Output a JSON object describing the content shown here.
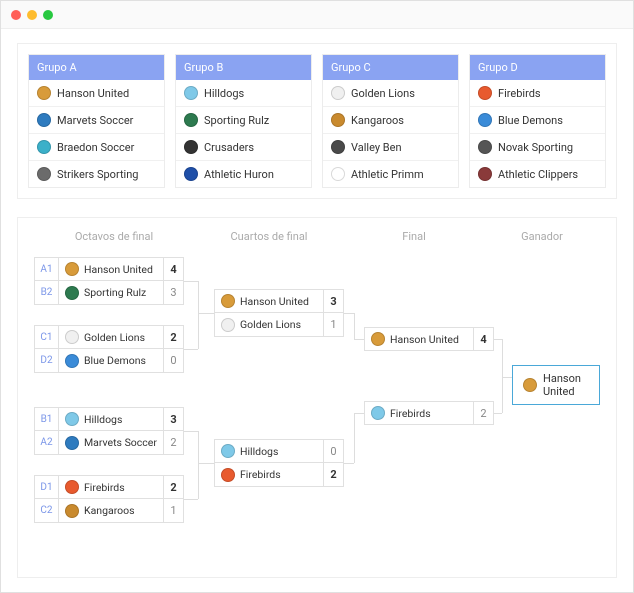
{
  "groups": [
    {
      "title": "Grupo A",
      "teams": [
        {
          "name": "Hanson United",
          "badge": "#d89b3a"
        },
        {
          "name": "Marvets Soccer",
          "badge": "#2e7bbf"
        },
        {
          "name": "Braedon Soccer",
          "badge": "#3bb0c9"
        },
        {
          "name": "Strikers Sporting",
          "badge": "#6b6b6b"
        }
      ]
    },
    {
      "title": "Grupo B",
      "teams": [
        {
          "name": "Hilldogs",
          "badge": "#7fc9e8"
        },
        {
          "name": "Sporting Rulz",
          "badge": "#2d7a4f"
        },
        {
          "name": "Crusaders",
          "badge": "#333333"
        },
        {
          "name": "Athletic Huron",
          "badge": "#1f4fa8"
        }
      ]
    },
    {
      "title": "Grupo C",
      "teams": [
        {
          "name": "Golden Lions",
          "badge": "#f0f0f0"
        },
        {
          "name": "Kangaroos",
          "badge": "#c98a2e"
        },
        {
          "name": "Valley Ben",
          "badge": "#4a4a4a"
        },
        {
          "name": "Athletic Primm",
          "badge": "#ffffff"
        }
      ]
    },
    {
      "title": "Grupo D",
      "teams": [
        {
          "name": "Firebirds",
          "badge": "#e85a2e"
        },
        {
          "name": "Blue Demons",
          "badge": "#3a8bd8"
        },
        {
          "name": "Novak Sporting",
          "badge": "#555555"
        },
        {
          "name": "Athletic Clippers",
          "badge": "#8a3a3a"
        }
      ]
    }
  ],
  "rounds": {
    "r16": "Octavos de final",
    "qf": "Cuartos de final",
    "final": "Final",
    "winner": "Ganador"
  },
  "bracket": {
    "r16": [
      {
        "slots": [
          {
            "seed": "A1",
            "name": "Hanson United",
            "badge": "#d89b3a",
            "score": "4",
            "win": true
          },
          {
            "seed": "B2",
            "name": "Sporting Rulz",
            "badge": "#2d7a4f",
            "score": "3",
            "win": false
          }
        ]
      },
      {
        "slots": [
          {
            "seed": "C1",
            "name": "Golden Lions",
            "badge": "#f0f0f0",
            "score": "2",
            "win": true
          },
          {
            "seed": "D2",
            "name": "Blue Demons",
            "badge": "#3a8bd8",
            "score": "0",
            "win": false
          }
        ]
      },
      {
        "slots": [
          {
            "seed": "B1",
            "name": "Hilldogs",
            "badge": "#7fc9e8",
            "score": "3",
            "win": true
          },
          {
            "seed": "A2",
            "name": "Marvets Soccer",
            "badge": "#2e7bbf",
            "score": "2",
            "win": false
          }
        ]
      },
      {
        "slots": [
          {
            "seed": "D1",
            "name": "Firebirds",
            "badge": "#e85a2e",
            "score": "2",
            "win": true
          },
          {
            "seed": "C2",
            "name": "Kangaroos",
            "badge": "#c98a2e",
            "score": "1",
            "win": false
          }
        ]
      }
    ],
    "qf": [
      {
        "slots": [
          {
            "name": "Hanson United",
            "badge": "#d89b3a",
            "score": "3",
            "win": true
          },
          {
            "name": "Golden Lions",
            "badge": "#f0f0f0",
            "score": "1",
            "win": false
          }
        ]
      },
      {
        "slots": [
          {
            "name": "Hilldogs",
            "badge": "#7fc9e8",
            "score": "0",
            "win": false
          },
          {
            "name": "Firebirds",
            "badge": "#e85a2e",
            "score": "2",
            "win": true
          }
        ]
      }
    ],
    "final": [
      {
        "slots": [
          {
            "name": "Hanson United",
            "badge": "#d89b3a",
            "score": "4",
            "win": true
          },
          {
            "name": "Firebirds",
            "badge": "#7fc9e8",
            "score": "2",
            "win": false
          }
        ]
      }
    ],
    "winner": {
      "name": "Hanson United",
      "badge": "#d89b3a"
    }
  }
}
